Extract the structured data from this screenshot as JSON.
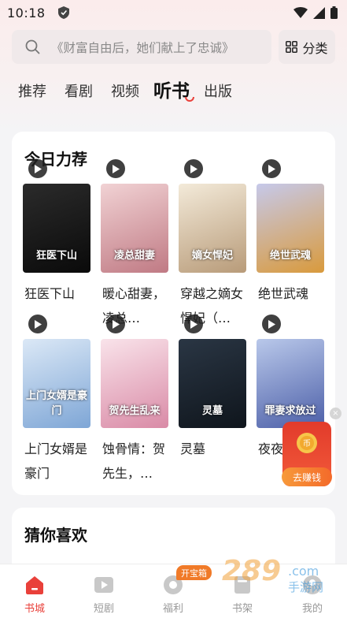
{
  "status": {
    "time": "10:18"
  },
  "search": {
    "placeholder": "《财富自由后，她们献上了忠诚》",
    "category_label": "分类"
  },
  "tabs": [
    {
      "label": "推荐"
    },
    {
      "label": "看剧"
    },
    {
      "label": "视频"
    },
    {
      "label": "听书"
    },
    {
      "label": "出版"
    }
  ],
  "recommend": {
    "title": "今日力荐",
    "books": [
      {
        "title": "狂医下山",
        "cover_text": "狂医下山",
        "colors": [
          "#2b2b2b",
          "#0a0a0a"
        ]
      },
      {
        "title": "暖心甜妻，凌总…",
        "cover_text": "凌总甜妻",
        "colors": [
          "#f1d2d4",
          "#c07a84"
        ]
      },
      {
        "title": "穿越之嫡女悍妃（…",
        "cover_text": "嫡女悍妃",
        "colors": [
          "#f3ead9",
          "#b89b79"
        ]
      },
      {
        "title": "绝世武魂",
        "cover_text": "绝世武魂",
        "colors": [
          "#c6c9ea",
          "#d99a3c"
        ]
      },
      {
        "title": "上门女婿是豪门",
        "cover_text": "上门女婿是豪门",
        "colors": [
          "#dbe8f6",
          "#7ea6d6"
        ]
      },
      {
        "title": "蚀骨情：贺先生，…",
        "cover_text": "贺先生乱来",
        "colors": [
          "#f9e3ea",
          "#d98aa6"
        ]
      },
      {
        "title": "灵墓",
        "cover_text": "灵墓",
        "colors": [
          "#2a3644",
          "#0f151c"
        ]
      },
      {
        "title": "夜夜情：…",
        "cover_text": "罪妻求放过",
        "colors": [
          "#b9c8ea",
          "#4c5fa8"
        ]
      }
    ]
  },
  "guess": {
    "title": "猜你喜欢"
  },
  "float_reward": {
    "button_label": "去赚钱"
  },
  "bottom_nav": {
    "treasure_badge": "开宝箱",
    "items": [
      {
        "label": "书城"
      },
      {
        "label": "短剧"
      },
      {
        "label": "福利"
      },
      {
        "label": "书架"
      },
      {
        "label": "我的"
      }
    ]
  },
  "watermark": {
    "text": "289",
    "suffix": "手游网"
  },
  "colors": {
    "accent": "#e9403a",
    "orange": "#f07a28"
  }
}
